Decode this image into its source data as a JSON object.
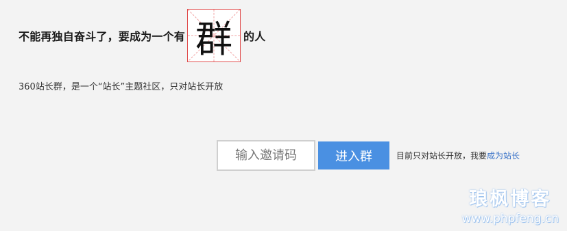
{
  "headline": {
    "text_before": "不能再独自奋斗了，要成为一个有",
    "highlight_char": "群",
    "text_after": "的人"
  },
  "subtitle": "360站长群，是一个“站长”主题社区，只对站长开放",
  "form": {
    "invite_placeholder": "输入邀请码",
    "enter_button": "进入群",
    "note_prefix": "目前只对站长开放，我要",
    "note_link": "成为站长"
  },
  "watermark": {
    "title": "琅枫博客",
    "url": "www.phpfeng.cn"
  },
  "colors": {
    "accent": "#4a90e2",
    "link": "#3a73c8",
    "grid_border": "#e04a4a",
    "background": "#f3f3f3"
  }
}
